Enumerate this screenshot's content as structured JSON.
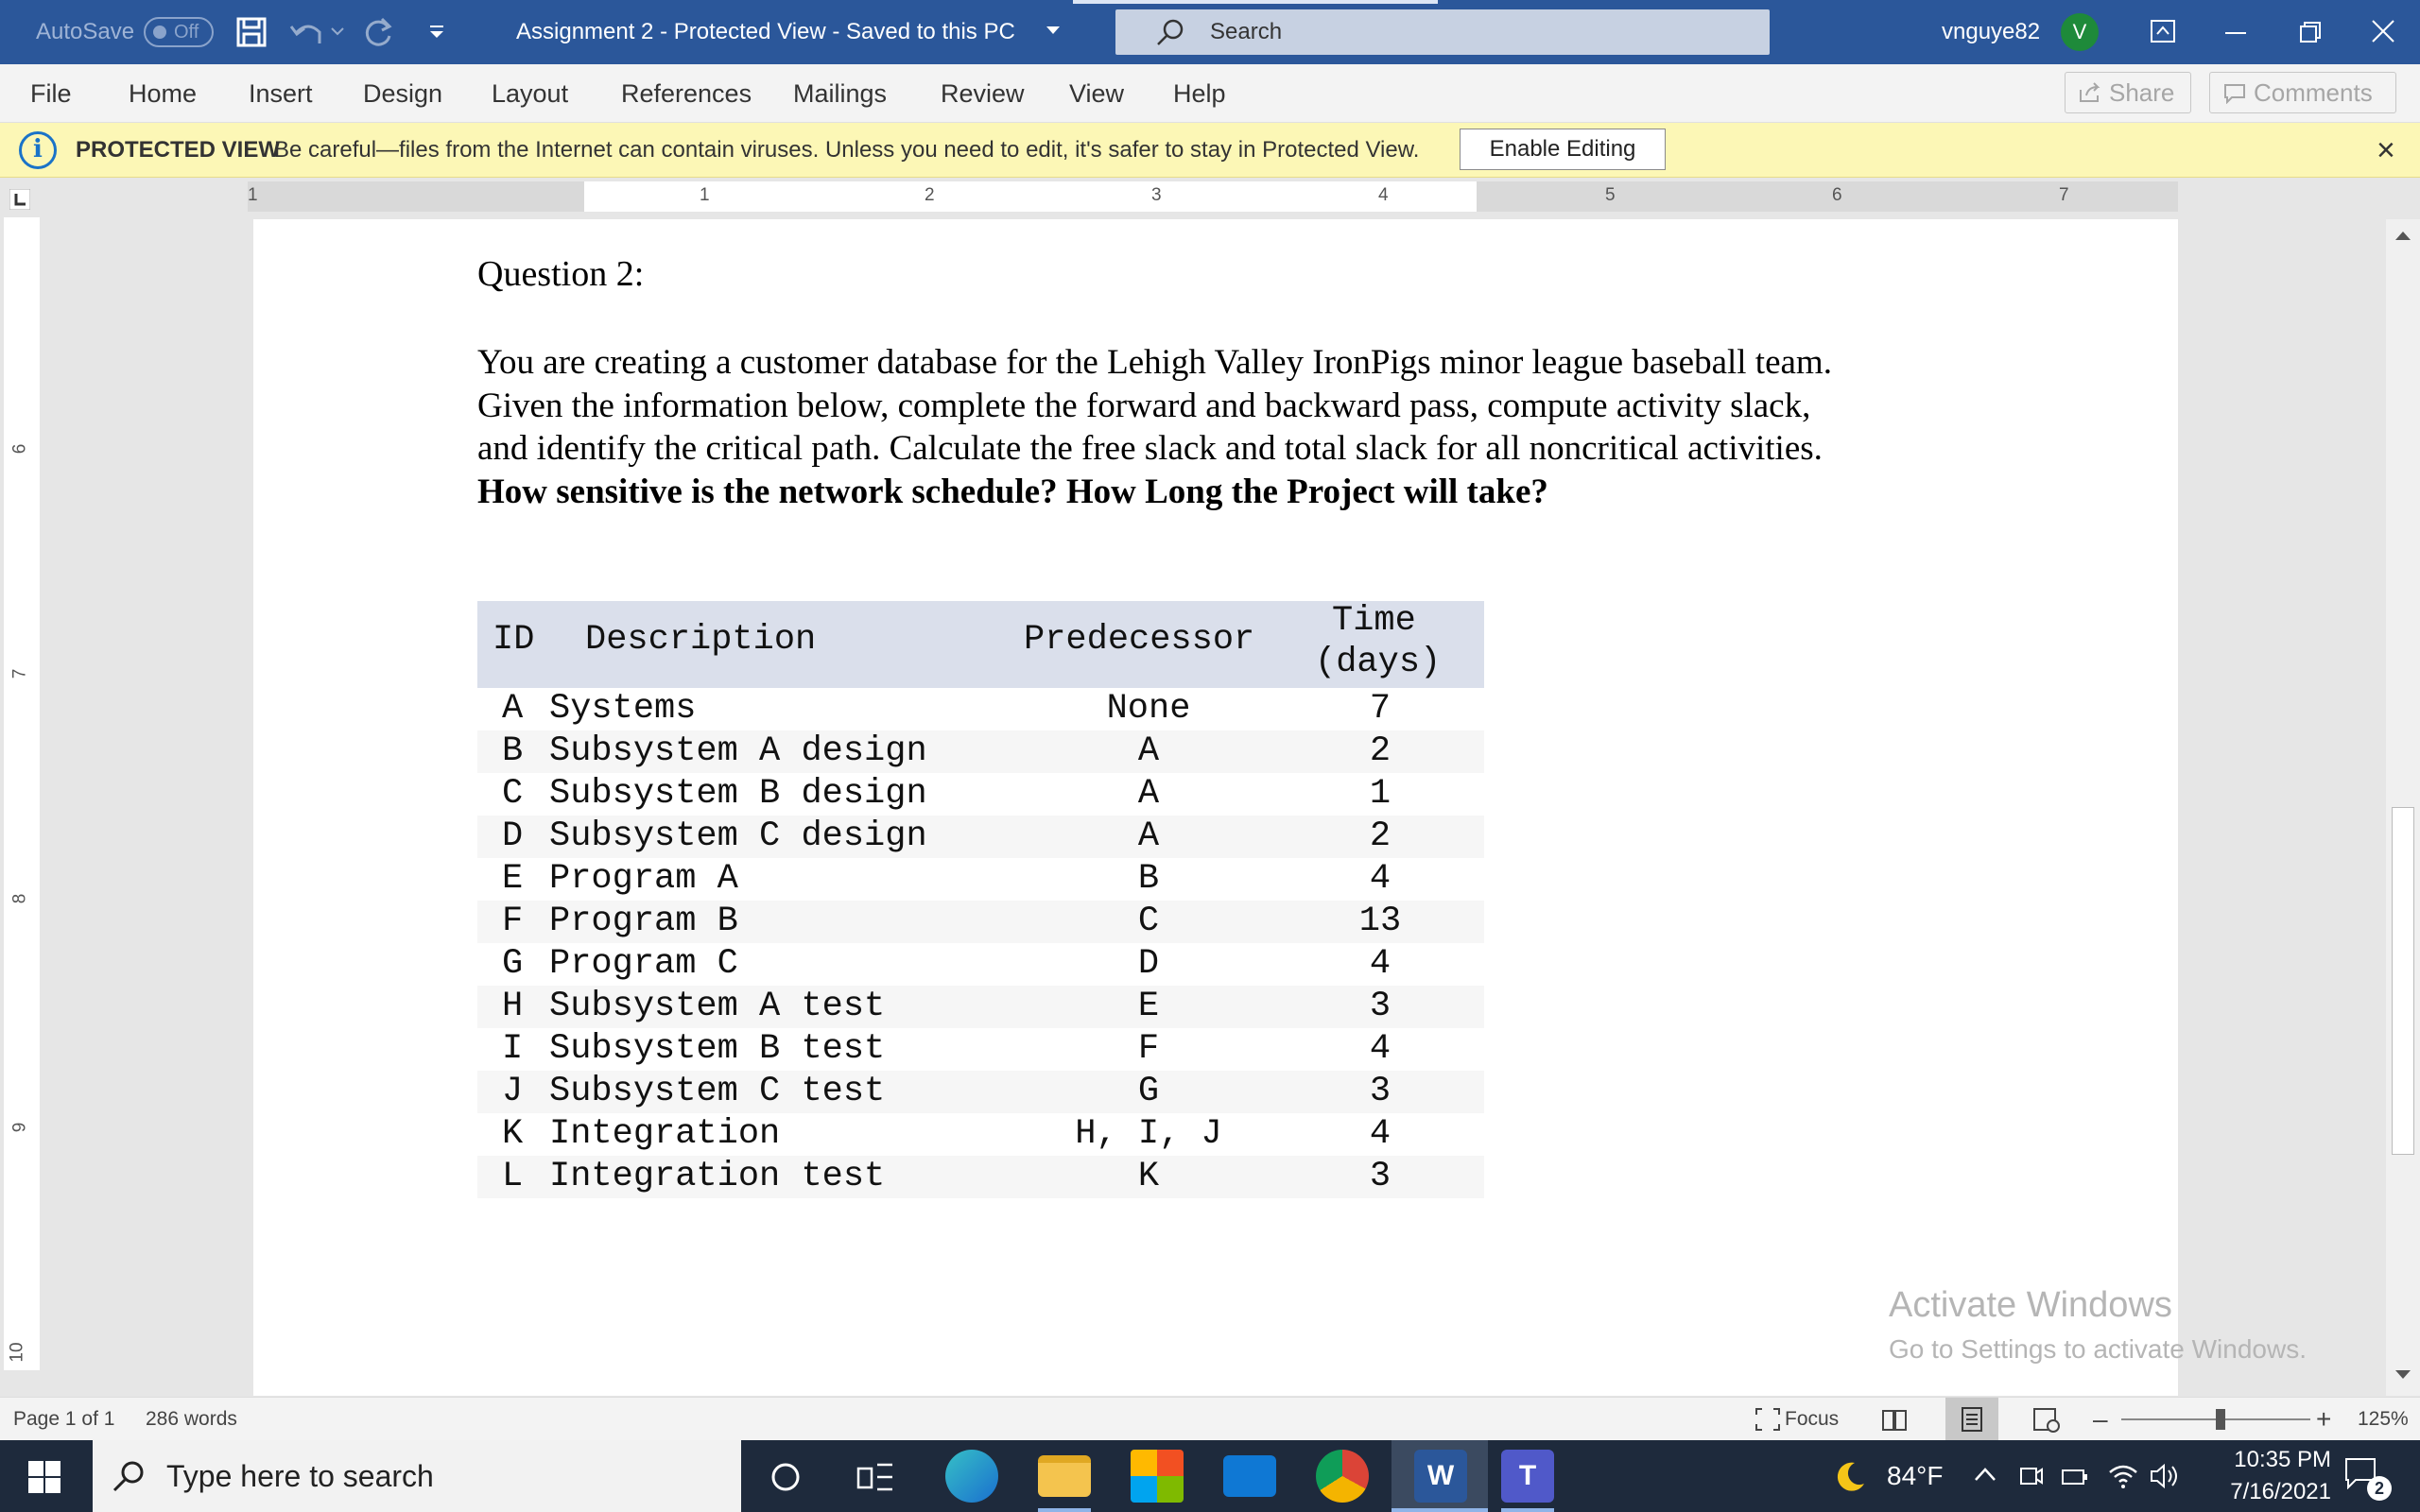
{
  "titlebar": {
    "autosave": "AutoSave",
    "autosave_state": "Off",
    "doc_title": "Assignment 2  -  Protected View  -  Saved to this PC",
    "search": "Search",
    "user": "vnguye82",
    "avatar_initial": "V"
  },
  "menu": {
    "items": [
      "File",
      "Home",
      "Insert",
      "Design",
      "Layout",
      "References",
      "Mailings",
      "Review",
      "View",
      "Help"
    ],
    "share": "Share",
    "comments": "Comments"
  },
  "protected_view": {
    "label": "PROTECTED VIEW",
    "message": "Be careful—files from the Internet can contain viruses. Unless you need to edit, it's safer to stay in Protected View.",
    "enable_button": "Enable Editing",
    "close": "×"
  },
  "ruler": {
    "horizontal": [
      "1",
      "1",
      "2",
      "3",
      "4",
      "5",
      "6",
      "7"
    ],
    "vertical": [
      "6",
      "7",
      "8",
      "9",
      "10"
    ]
  },
  "document": {
    "question_title": "Question 2:",
    "paragraph_lines": [
      "You are creating a customer database for the Lehigh Valley IronPigs minor league baseball team.",
      "Given the information below, complete the forward and backward pass, compute activity slack,",
      "and identify the critical path. Calculate the free slack and total slack for all noncritical activities."
    ],
    "bold_line": "How sensitive is the network schedule? How Long the Project will take?",
    "table": {
      "headers": {
        "id": "ID",
        "description": "Description",
        "predecessor": "Predecessor",
        "time_line1": "Time",
        "time_line2": "(days)"
      },
      "rows": [
        {
          "id": "A",
          "description": "Systems",
          "predecessor": "None",
          "time": "7"
        },
        {
          "id": "B",
          "description": "Subsystem A design",
          "predecessor": "A",
          "time": "2"
        },
        {
          "id": "C",
          "description": "Subsystem B design",
          "predecessor": "A",
          "time": "1"
        },
        {
          "id": "D",
          "description": "Subsystem C design",
          "predecessor": "A",
          "time": "2"
        },
        {
          "id": "E",
          "description": "Program A",
          "predecessor": "B",
          "time": "4"
        },
        {
          "id": "F",
          "description": "Program B",
          "predecessor": "C",
          "time": "13"
        },
        {
          "id": "G",
          "description": "Program C",
          "predecessor": "D",
          "time": "4"
        },
        {
          "id": "H",
          "description": "Subsystem A test",
          "predecessor": "E",
          "time": "3"
        },
        {
          "id": "I",
          "description": "Subsystem B test",
          "predecessor": "F",
          "time": "4"
        },
        {
          "id": "J",
          "description": "Subsystem C test",
          "predecessor": "G",
          "time": "3"
        },
        {
          "id": "K",
          "description": "Integration",
          "predecessor": "H, I, J",
          "time": "4"
        },
        {
          "id": "L",
          "description": "Integration test",
          "predecessor": "K",
          "time": "3"
        }
      ]
    }
  },
  "watermark": {
    "line1": "Activate Windows",
    "line2": "Go to Settings to activate Windows."
  },
  "statusbar": {
    "page": "Page 1 of 1",
    "words": "286 words",
    "focus": "Focus",
    "zoom": "125%"
  },
  "taskbar": {
    "search_placeholder": "Type here to search",
    "weather": "84°F",
    "time": "10:35 PM",
    "date": "7/16/2021",
    "notifications": "2"
  }
}
